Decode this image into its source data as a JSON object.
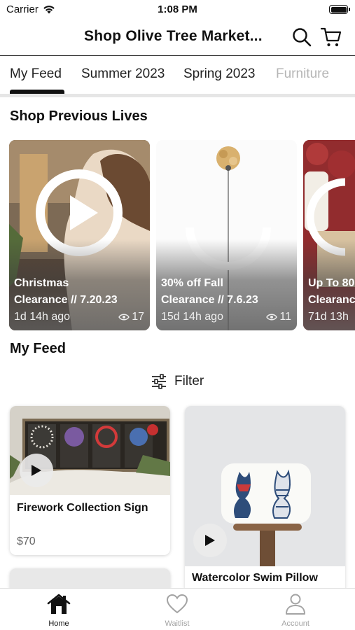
{
  "status_bar": {
    "carrier": "Carrier",
    "time": "1:08 PM"
  },
  "nav": {
    "title": "Shop Olive Tree Market...",
    "search_icon": "search-icon",
    "cart_icon": "cart-icon"
  },
  "tabs": [
    {
      "label": "My Feed",
      "active": true
    },
    {
      "label": "Summer 2023"
    },
    {
      "label": "Spring 2023"
    },
    {
      "label": "Furniture"
    }
  ],
  "previous_lives": {
    "title": "Shop Previous Lives",
    "items": [
      {
        "line1": "Christmas",
        "line2": "Clearance // 7.20.23",
        "time": "1d 14h ago",
        "views": "17"
      },
      {
        "line1": "30% off Fall",
        "line2": "Clearance // 7.6.23",
        "time": "15d 14h ago",
        "views": "11"
      },
      {
        "line1": "Up To 80",
        "line2": "Clearanc",
        "time": "71d 13h"
      }
    ]
  },
  "feed": {
    "title": "My Feed",
    "filter_label": "Filter",
    "products": [
      {
        "name": "Firework Collection Sign",
        "price": "$70"
      },
      {
        "name": "Watercolor Swim Pillow"
      }
    ]
  },
  "bottom_tabs": [
    {
      "label": "Home",
      "icon": "home-icon",
      "active": true
    },
    {
      "label": "Waitlist",
      "icon": "heart-icon"
    },
    {
      "label": "Account",
      "icon": "person-icon"
    }
  ],
  "colors": {
    "accent": "#111111",
    "inactive": "#a3a3a3",
    "divider": "#e6e6e6"
  }
}
